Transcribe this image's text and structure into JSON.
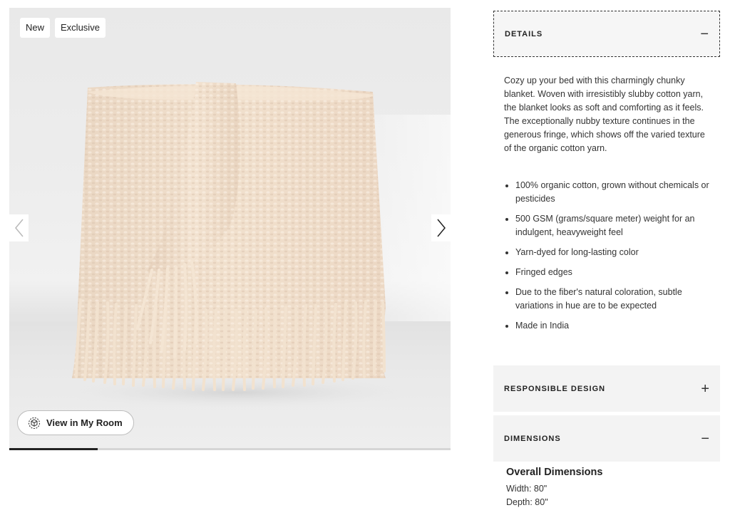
{
  "gallery": {
    "badges": [
      "New",
      "Exclusive"
    ],
    "view_room_label": "View in My Room",
    "progress_fraction": 0.2
  },
  "details": {
    "title": "DETAILS",
    "sign": "−",
    "description": "Cozy up your bed with this charmingly chunky blanket. Woven with irresistibly slubby cotton yarn, the blanket looks as soft and comforting as it feels. The exceptionally nubby texture continues in the generous fringe, which shows off the varied texture of the organic cotton yarn.",
    "features": [
      "100% organic cotton, grown without chemicals or pesticides",
      "500 GSM (grams/square meter) weight for an indulgent, heavyweight feel",
      "Yarn-dyed for long-lasting color",
      "Fringed edges",
      "Due to the fiber's natural coloration, subtle variations in hue are to be expected",
      "Made in India"
    ]
  },
  "responsible": {
    "title": "RESPONSIBLE DESIGN",
    "sign": "+"
  },
  "dimensions": {
    "title": "DIMENSIONS",
    "sign": "−",
    "heading": "Overall Dimensions",
    "width": "Width: 80\"",
    "depth": "Depth: 80\""
  },
  "colors": {
    "blanket": "#efdcc8",
    "accent": "#222222"
  }
}
